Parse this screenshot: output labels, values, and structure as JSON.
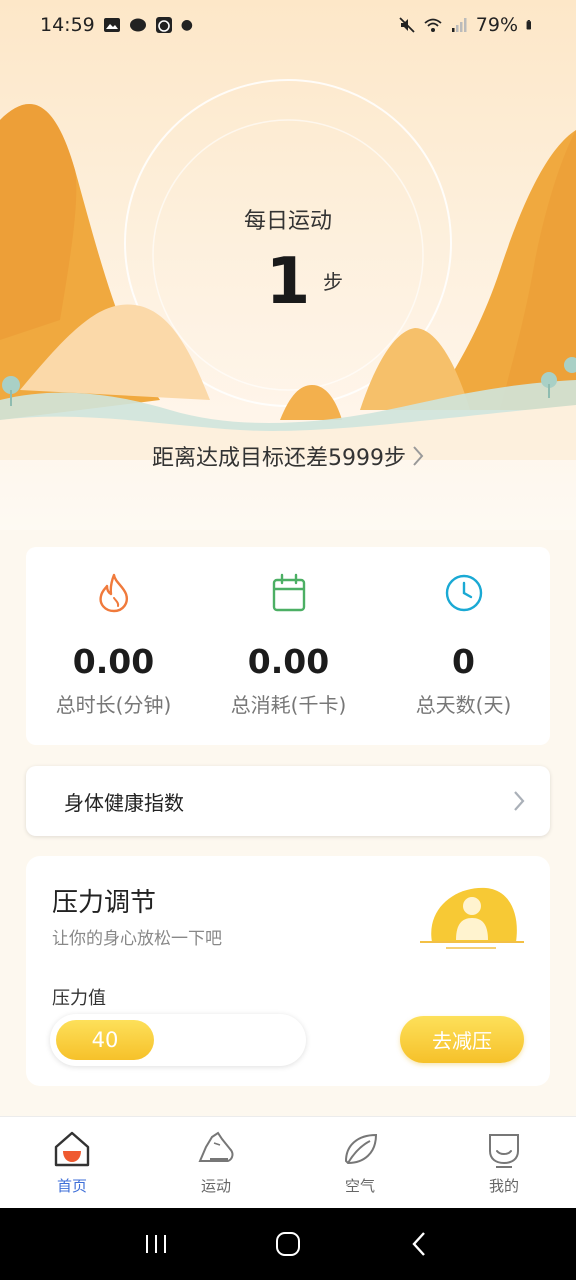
{
  "status_bar": {
    "time": "14:59",
    "battery": "79%"
  },
  "hero": {
    "title": "每日运动",
    "steps": "1",
    "unit": "步",
    "goal_text": "距离达成目标还差5999步"
  },
  "stats": [
    {
      "icon": "flame-icon",
      "value": "0.00",
      "label": "总时长(分钟)",
      "color": "#f07a3c"
    },
    {
      "icon": "calendar-icon",
      "value": "0.00",
      "label": "总消耗(千卡)",
      "color": "#4caf64"
    },
    {
      "icon": "clock-icon",
      "value": "0",
      "label": "总天数(天)",
      "color": "#1aa9d4"
    }
  ],
  "health": {
    "title": "身体健康指数"
  },
  "stress": {
    "title": "压力调节",
    "subtitle": "让你的身心放松一下吧",
    "value_label": "压力值",
    "value": "40",
    "level": 0.4,
    "button": "去减压"
  },
  "tabs": [
    {
      "label": "首页",
      "icon": "home-icon",
      "active": true
    },
    {
      "label": "运动",
      "icon": "sneaker-icon",
      "active": false
    },
    {
      "label": "空气",
      "icon": "leaf-icon",
      "active": false
    },
    {
      "label": "我的",
      "icon": "profile-icon",
      "active": false
    }
  ],
  "colors": {
    "accent_yellow": "#f6c12a",
    "active_tab": "#3f6fd8",
    "mountain_orange": "#f2a63c"
  }
}
